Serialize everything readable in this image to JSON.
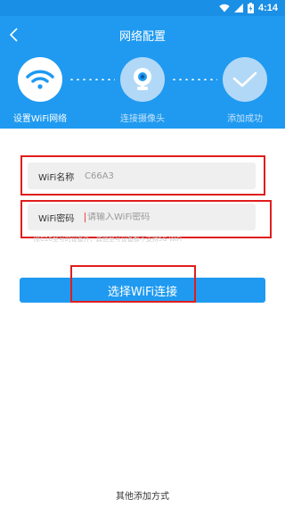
{
  "status_bar": {
    "time": "4:14"
  },
  "header": {
    "title": "网络配置"
  },
  "steps": [
    {
      "label": "设置WiFi网络",
      "icon": "wifi-icon",
      "state": "active"
    },
    {
      "label": "连接摄像头",
      "icon": "camera-icon",
      "state": "inactive"
    },
    {
      "label": "添加成功",
      "icon": "checkmark-icon",
      "state": "inactive"
    }
  ],
  "form": {
    "wifi_name_label": "WiFi名称",
    "wifi_name_value": "C66A3",
    "wifi_password_label": "WiFi密码",
    "wifi_password_placeholder": "请输入WiFi密码",
    "hint": "除C16型号的设备外，其他型号设备都不支持5G WiFi"
  },
  "connect_button_label": "选择WiFi连接",
  "other_method_label": "其他添加方式",
  "colors": {
    "primary": "#1f9af0",
    "status_bar": "#1a8fe6",
    "highlight": "#e01d1d"
  }
}
